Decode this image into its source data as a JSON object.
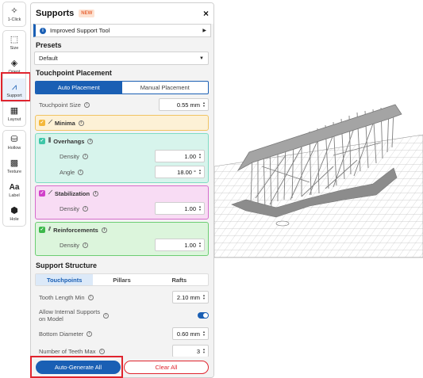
{
  "toolbar": {
    "items": [
      {
        "label": "1-Click",
        "icon": "magic-wand-icon"
      },
      {
        "label": "Size",
        "icon": "resize-icon"
      },
      {
        "label": "Orient",
        "icon": "orient-icon"
      },
      {
        "label": "Support",
        "icon": "support-icon"
      },
      {
        "label": "Layout",
        "icon": "layout-icon"
      },
      {
        "label": "Hollow",
        "icon": "hollow-icon"
      },
      {
        "label": "Texture",
        "icon": "texture-icon"
      },
      {
        "label": "Label",
        "icon": "label-icon",
        "glyph": "Aa"
      },
      {
        "label": "Hole",
        "icon": "hole-icon"
      }
    ],
    "selected": "Support"
  },
  "panel": {
    "title": "Supports",
    "badge": "NEW",
    "close": "×",
    "banner": "Improved Support Tool",
    "presets": {
      "title": "Presets",
      "value": "Default"
    },
    "touchpoint": {
      "title": "Touchpoint Placement",
      "modes": [
        "Auto Placement",
        "Manual Placement"
      ],
      "size_label": "Touchpoint Size",
      "size_value": "0.55 mm"
    },
    "minima": {
      "label": "Minima",
      "color": "#f4b73a"
    },
    "overhangs": {
      "label": "Overhangs",
      "color": "#3ec6a7",
      "density_label": "Density",
      "density": "1.00",
      "angle_label": "Angle",
      "angle": "18.00 °"
    },
    "stabilization": {
      "label": "Stabilization",
      "color": "#d13fc9",
      "density_label": "Density",
      "density": "1.00"
    },
    "reinforcements": {
      "label": "Reinforcements",
      "color": "#3cb84a",
      "density_label": "Density",
      "density": "1.00"
    },
    "structure": {
      "title": "Support Structure",
      "tabs": [
        "Touchpoints",
        "Pillars",
        "Rafts"
      ],
      "tooth_length_label": "Tooth Length Min",
      "tooth_length": "2.10 mm",
      "allow_internal_label_1": "Allow Internal Supports",
      "allow_internal_label_2": "on Model",
      "bottom_diameter_label": "Bottom Diameter",
      "bottom_diameter": "0.60 mm",
      "teeth_max_label": "Number of Teeth Max",
      "teeth_max": "3"
    },
    "footer": {
      "primary": "Auto-Generate All",
      "secondary": "Clear All"
    }
  },
  "colors": {
    "accent": "#1a5fb4",
    "highlight": "#e0242e"
  }
}
